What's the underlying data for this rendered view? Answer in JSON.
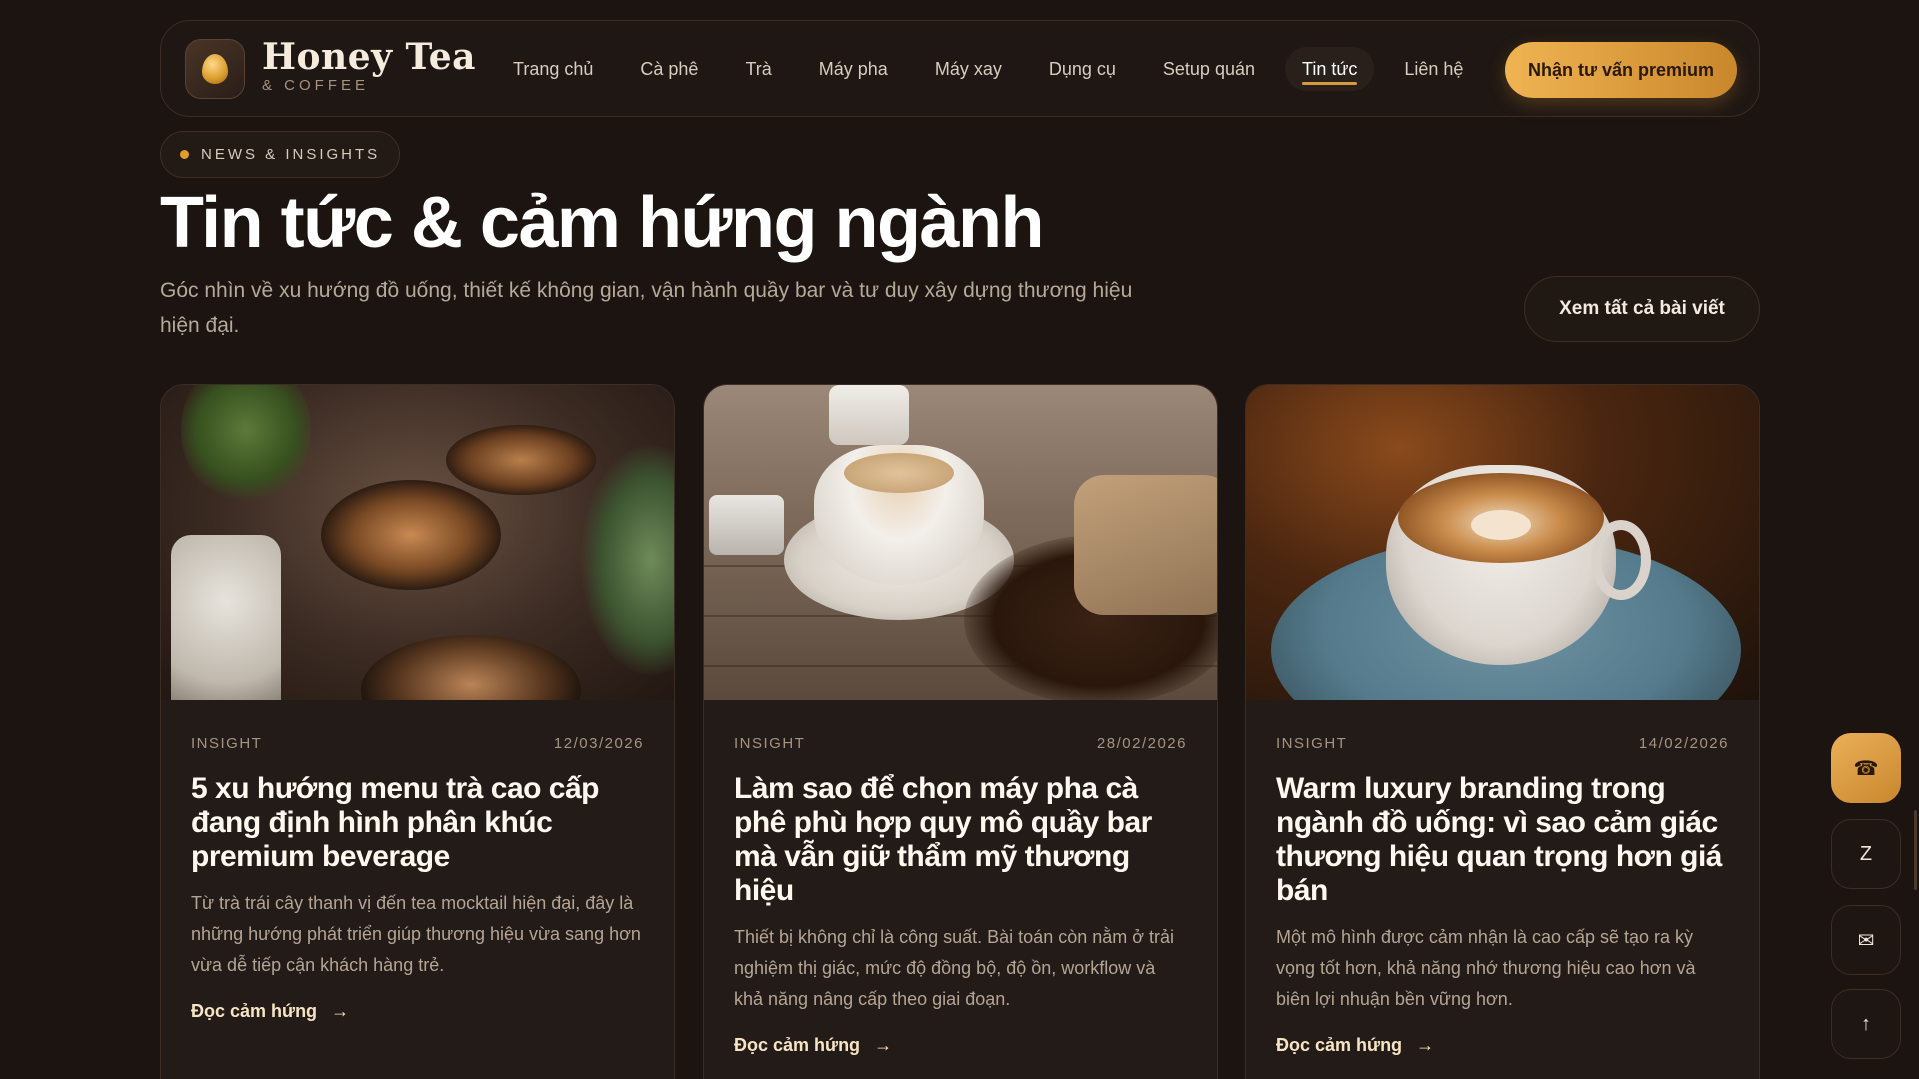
{
  "brand": {
    "name": "Honey Tea",
    "sub": "& COFFEE",
    "logo_icon": "honey-drop-icon"
  },
  "nav": {
    "items": [
      "Trang chủ",
      "Cà phê",
      "Trà",
      "Máy pha",
      "Máy xay",
      "Dụng cụ",
      "Setup quán",
      "Tin tức",
      "Liên hệ"
    ],
    "active": "Tin tức",
    "cta": "Nhận tư vấn premium"
  },
  "hero": {
    "pill": "NEWS & INSIGHTS",
    "title": "Tin tức & cảm hứng ngành",
    "subtitle": "Góc nhìn về xu hướng đồ uống, thiết kế không gian, vận hành quầy bar và tư duy xây dựng thương hiệu hiện đại.",
    "see_all": "Xem tất cả bài viết"
  },
  "articles": [
    {
      "category": "INSIGHT",
      "date": "12/03/2026",
      "title": "5 xu hướng menu trà cao cấp đang định hình phân khúc premium beverage",
      "desc": "Từ trà trái cây thanh vị đến tea mocktail hiện đại, đây là những hướng phát triển giúp thương hiệu vừa sang hơn vừa dễ tiếp cận khách hàng trẻ.",
      "read_more": "Đọc cảm hứng",
      "image_icon": "latte-art-photo"
    },
    {
      "category": "INSIGHT",
      "date": "28/02/2026",
      "title": "Làm sao để chọn máy pha cà phê phù hợp quy mô quầy bar mà vẫn giữ thẩm mỹ thương hiệu",
      "desc": "Thiết bị không chỉ là công suất. Bài toán còn nằm ở trải nghiệm thị giác, mức độ đồng bộ, độ ồn, workflow và khả năng nâng cấp theo giai đoạn.",
      "read_more": "Đọc cảm hứng",
      "image_icon": "coffee-beans-photo"
    },
    {
      "category": "INSIGHT",
      "date": "14/02/2026",
      "title": "Warm luxury branding trong ngành đồ uống: vì sao cảm giác thương hiệu quan trọng hơn giá bán",
      "desc": "Một mô hình được cảm nhận là cao cấp sẽ tạo ra kỳ vọng tốt hơn, khả năng nhớ thương hiệu cao hơn và biên lợi nhuận bền vững hơn.",
      "read_more": "Đọc cảm hứng",
      "image_icon": "cappuccino-photo"
    }
  ],
  "floating": {
    "phone_icon": "phone-icon",
    "zalo_label": "Z",
    "mail_icon": "mail-icon",
    "top_icon": "arrow-up-icon"
  },
  "colors": {
    "accent": "#e9a544",
    "background": "#1b1411",
    "card": "#231b17"
  }
}
